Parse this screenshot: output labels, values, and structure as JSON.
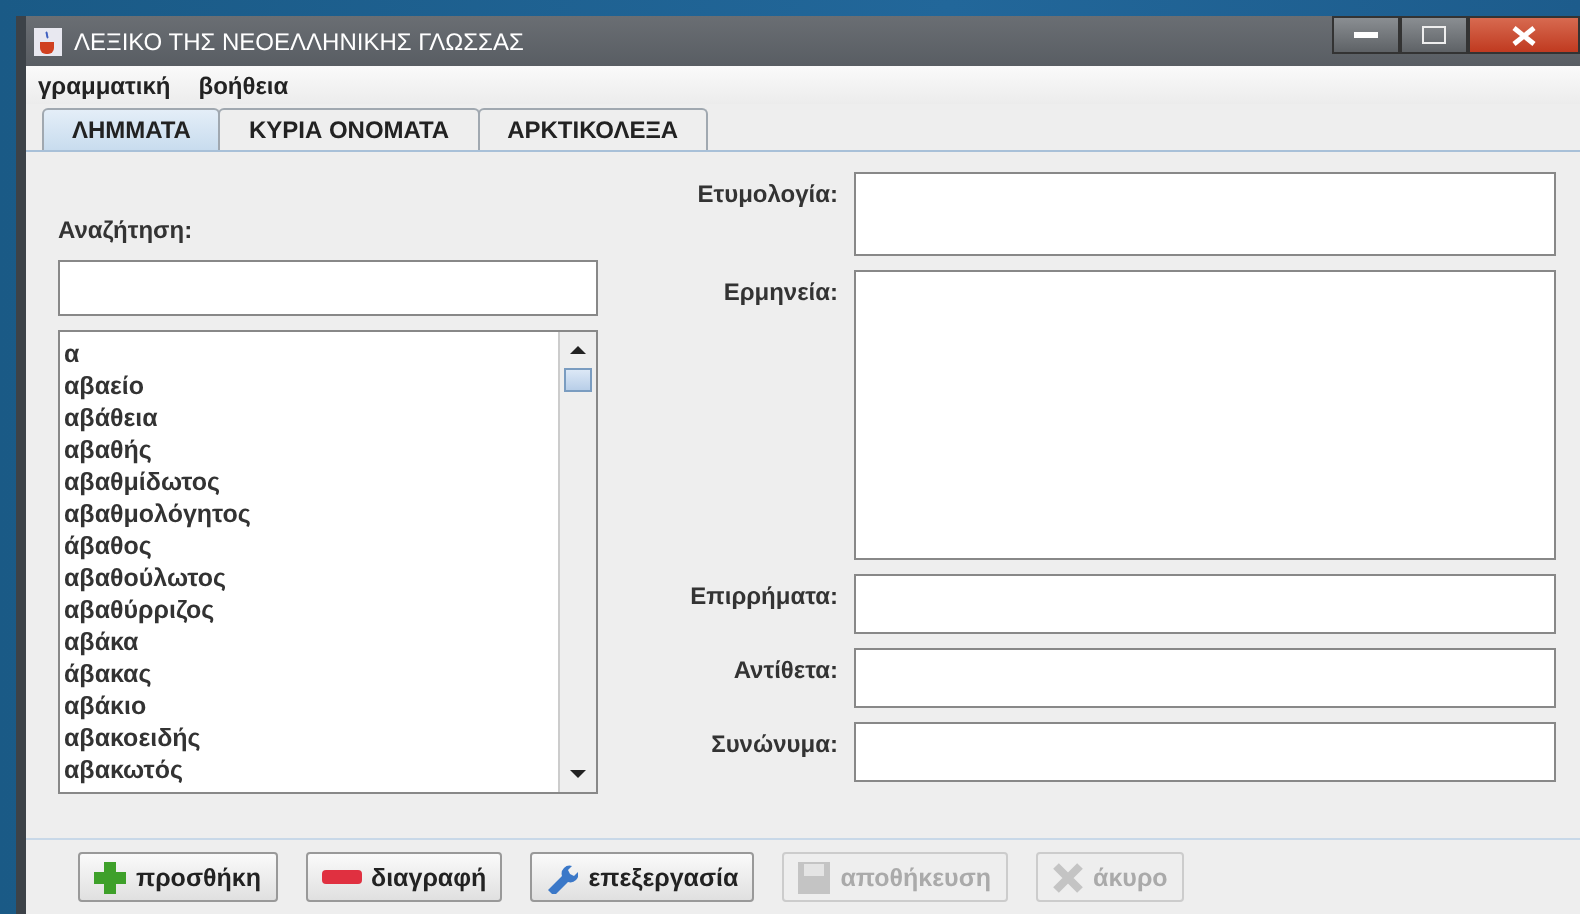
{
  "window": {
    "title": "ΛΕΞΙΚΟ ΤΗΣ ΝΕΟΕΛΛΗΝΙΚΗΣ ΓΛΩΣΣΑΣ"
  },
  "menu": [
    "γραμματική",
    "βοήθεια"
  ],
  "tabs": [
    {
      "label": "ΛΗΜΜΑΤΑ",
      "selected": true
    },
    {
      "label": "ΚΥΡΙΑ ΟΝΟΜΑΤΑ",
      "selected": false
    },
    {
      "label": "ΑΡΚΤΙΚΟΛΕΞΑ",
      "selected": false
    }
  ],
  "search": {
    "label": "Αναζήτηση:"
  },
  "word_list": [
    "α",
    "αβαείο",
    "αβάθεια",
    "αβαθής",
    "αβαθμίδωτος",
    "αβαθμολόγητος",
    "άβαθος",
    "αβαθούλωτος",
    "αβαθύρριζος",
    "αβάκα",
    "άβακας",
    "αβάκιο",
    "αβακοειδής",
    "αβακωτός"
  ],
  "fields": [
    {
      "label": "Ετυμολογία:"
    },
    {
      "label": "Ερμηνεία:"
    },
    {
      "label": "Επιρρήματα:"
    },
    {
      "label": "Αντίθετα:"
    },
    {
      "label": "Συνώνυμα:"
    }
  ],
  "buttons": [
    {
      "label": "προσθήκη",
      "kind": "add",
      "disabled": false
    },
    {
      "label": "διαγραφή",
      "kind": "delete",
      "disabled": false
    },
    {
      "label": "επεξεργασία",
      "kind": "edit",
      "disabled": false
    },
    {
      "label": "αποθήκευση",
      "kind": "save",
      "disabled": true
    },
    {
      "label": "άκυρο",
      "kind": "cancel",
      "disabled": true
    }
  ]
}
